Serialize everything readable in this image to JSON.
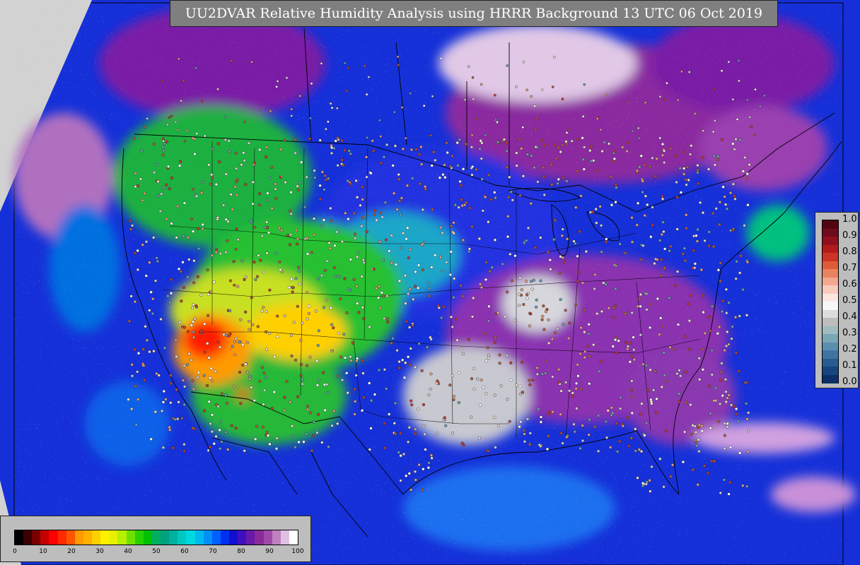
{
  "map": {
    "title": "UU2DVAR Relative Humidity Analysis using HRRR Background 13 UTC 06 Oct 2019"
  },
  "bias_legend": {
    "ticks": [
      "1.0",
      "0.9",
      "0.8",
      "0.7",
      "0.6",
      "0.5",
      "0.4",
      "0.3",
      "0.2",
      "0.1",
      "0.0"
    ],
    "colors": [
      "#f7f7f7",
      "#dcdcdc",
      "#bdbdbd",
      "#9fbcc0",
      "#7aa7b5",
      "#5b8fae",
      "#3f74a3",
      "#285c93",
      "#17457f",
      "#0b2f66",
      "#fbe7e0",
      "#f7cbbd",
      "#f1a88f",
      "#e9825f",
      "#de5b3a",
      "#cc3324",
      "#b31b1b",
      "#8f0f1e",
      "#6f0a1a",
      "#520414"
    ]
  },
  "rh_legend": {
    "ticks": [
      "0",
      "10",
      "20",
      "30",
      "40",
      "50",
      "60",
      "70",
      "80",
      "90",
      "100"
    ],
    "colors": [
      "#000000",
      "#3b0000",
      "#7a0000",
      "#c40000",
      "#ff0000",
      "#ff2a00",
      "#ff5500",
      "#ff9a00",
      "#ffb000",
      "#ffd000",
      "#fff000",
      "#e6f000",
      "#b4f000",
      "#6ee000",
      "#28d000",
      "#00c000",
      "#00b060",
      "#00a080",
      "#00b0a0",
      "#00c8c0",
      "#00d8e0",
      "#00b8f0",
      "#0090f8",
      "#0060ff",
      "#0030f0",
      "#1010d0",
      "#4010c0",
      "#6a1aa8",
      "#8a2a98",
      "#a04aa8",
      "#c080c0",
      "#e0c0e0",
      "#ffffff"
    ]
  }
}
